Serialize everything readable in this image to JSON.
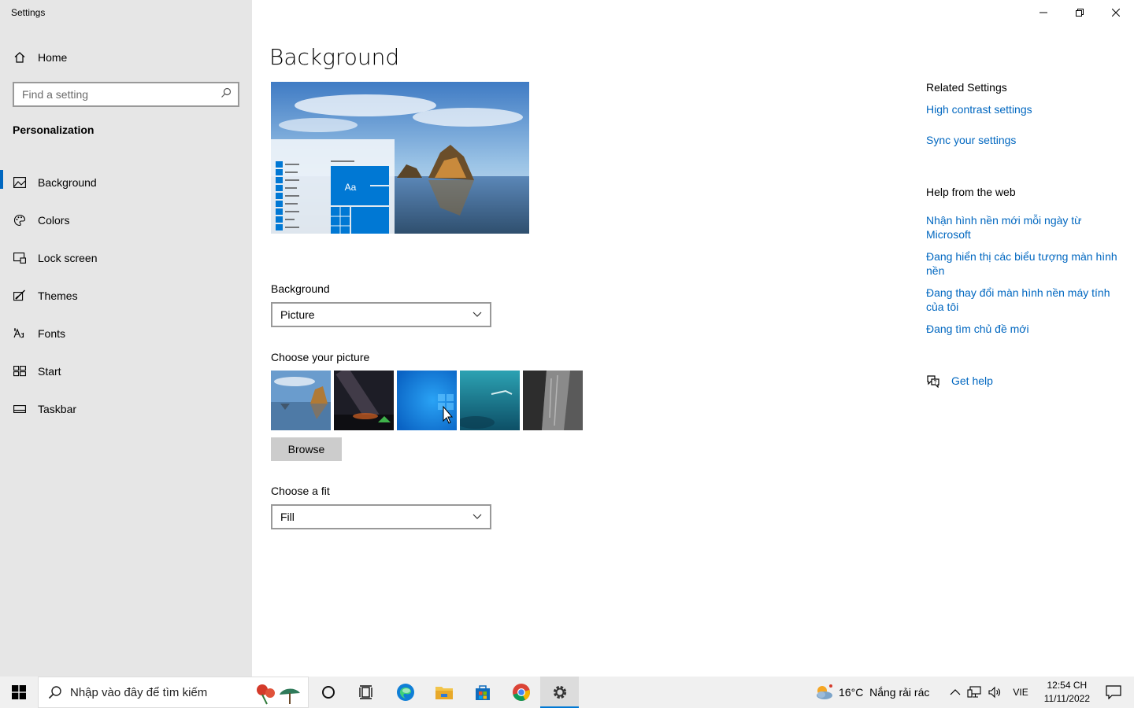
{
  "window": {
    "title": "Settings"
  },
  "sidebar": {
    "home_label": "Home",
    "search_placeholder": "Find a setting",
    "section_title": "Personalization",
    "items": [
      {
        "label": "Background",
        "icon": "picture-icon",
        "active": true
      },
      {
        "label": "Colors",
        "icon": "palette-icon",
        "active": false
      },
      {
        "label": "Lock screen",
        "icon": "lock-screen-icon",
        "active": false
      },
      {
        "label": "Themes",
        "icon": "themes-icon",
        "active": false
      },
      {
        "label": "Fonts",
        "icon": "fonts-icon",
        "active": false
      },
      {
        "label": "Start",
        "icon": "start-icon",
        "active": false
      },
      {
        "label": "Taskbar",
        "icon": "taskbar-icon",
        "active": false
      }
    ]
  },
  "main": {
    "title": "Background",
    "preview_tile_text": "Aa",
    "background_label": "Background",
    "background_value": "Picture",
    "choose_picture_label": "Choose your picture",
    "browse_label": "Browse",
    "fit_label": "Choose a fit",
    "fit_value": "Fill"
  },
  "related": {
    "heading": "Related Settings",
    "links": [
      "High contrast settings",
      "Sync your settings"
    ]
  },
  "help": {
    "heading": "Help from the web",
    "links": [
      "Nhận hình nền mới mỗi ngày từ Microsoft",
      "Đang hiển thị các biểu tượng màn hình nền",
      "Đang thay đổi màn hình nền máy tính của tôi",
      "Đang tìm chủ đề mới"
    ],
    "get_help": "Get help"
  },
  "taskbar": {
    "search_placeholder": "Nhập vào đây để tìm kiếm",
    "weather": "16°C  Nắng rải rác",
    "language": "VIE",
    "time": "12:54 CH",
    "date": "11/11/2022"
  },
  "colors": {
    "accent": "#0067c0",
    "sidebar_bg": "#e6e6e6",
    "taskbar_bg": "#f0f0f0"
  }
}
